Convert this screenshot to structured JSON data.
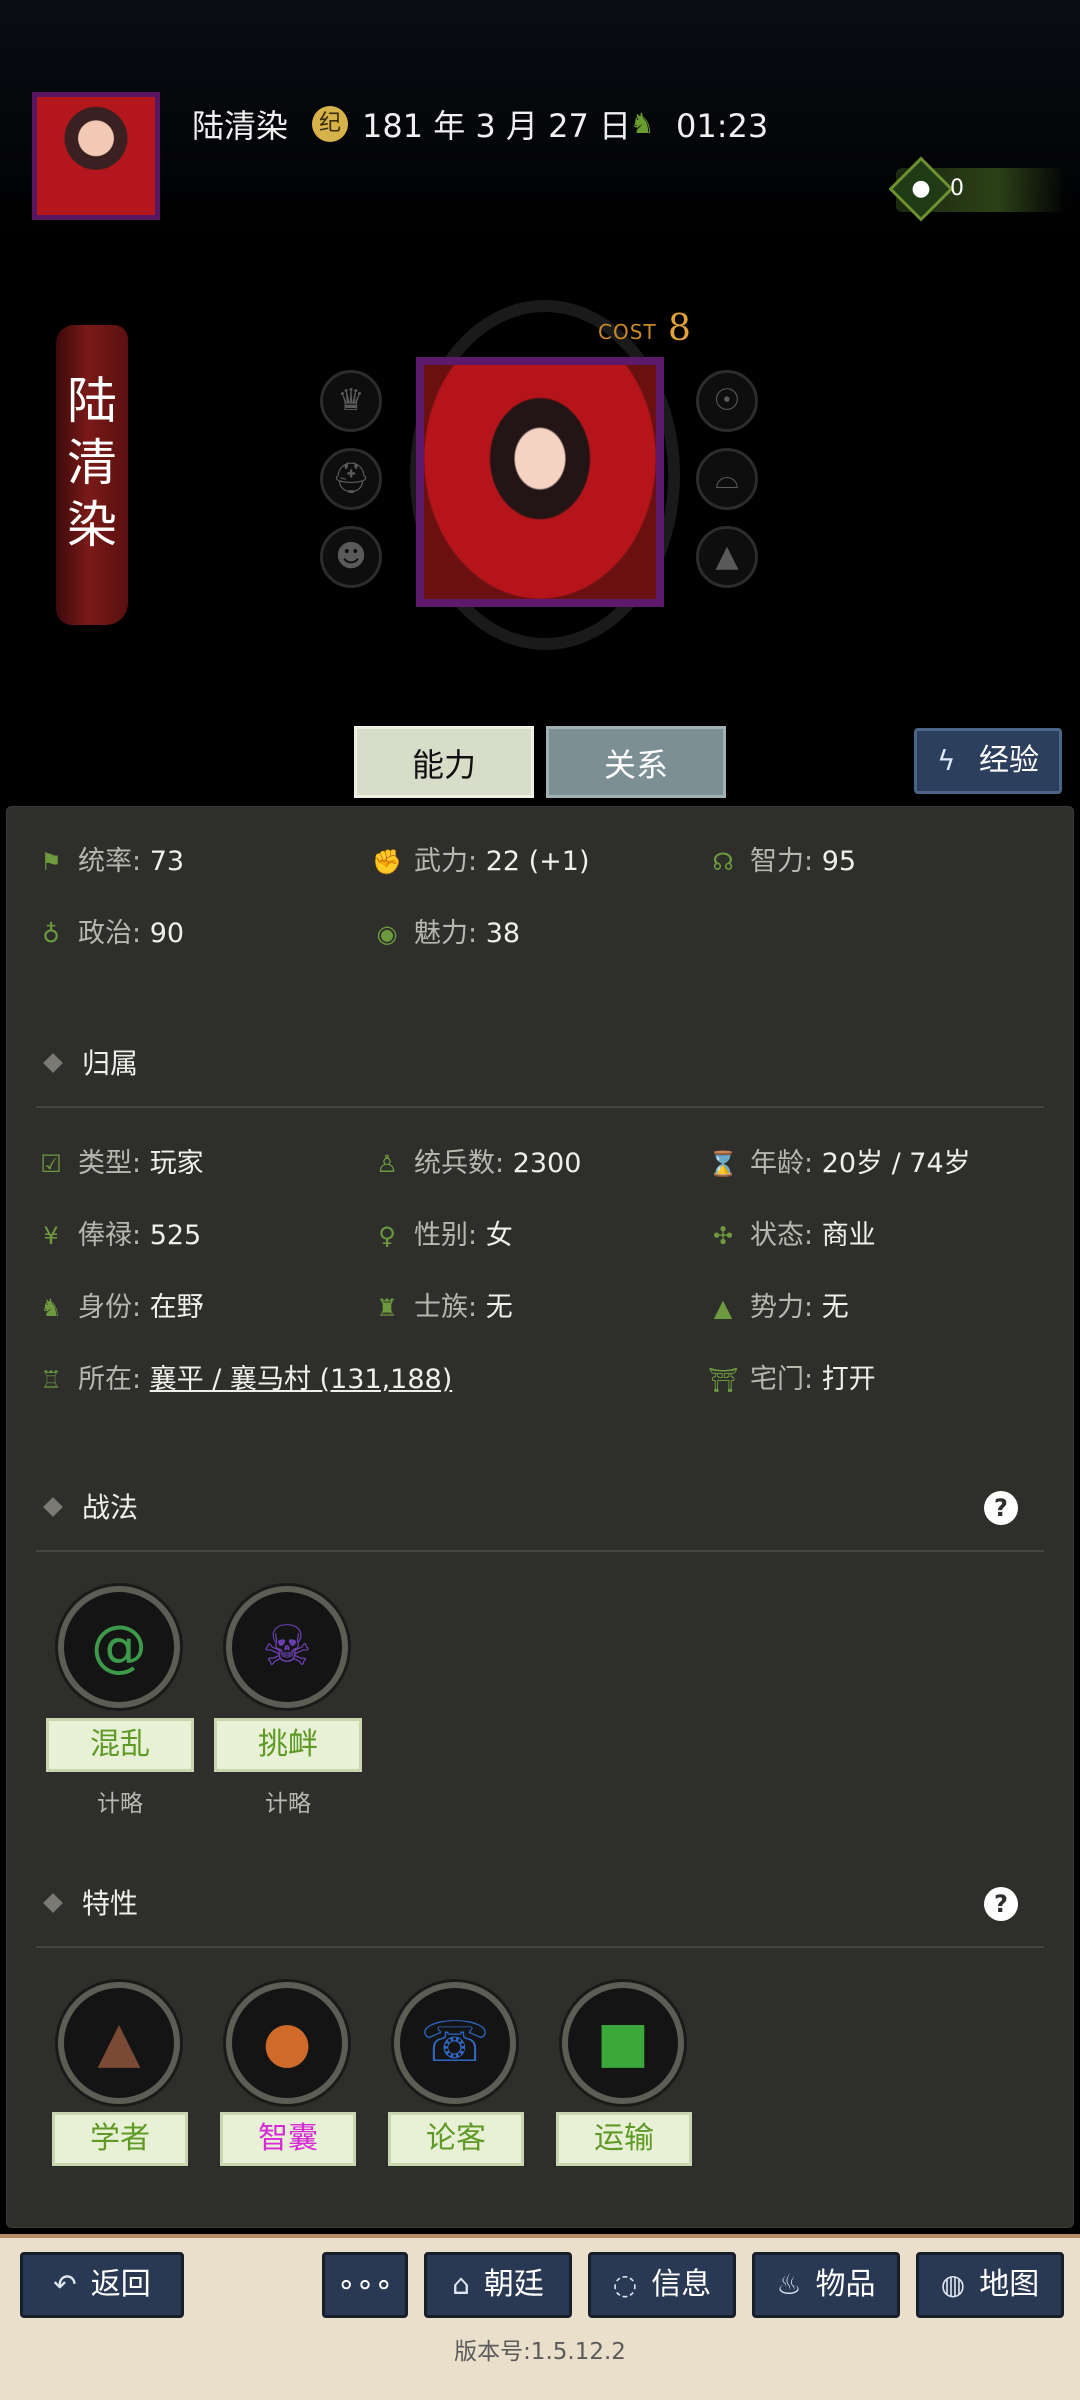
{
  "header": {
    "player_name": "陆清染",
    "date": "181 年 3 月 27 日",
    "time": "01:23",
    "gem_count": "0"
  },
  "character": {
    "name_vertical": [
      "陆",
      "清",
      "染"
    ],
    "cost_label": "COST",
    "cost_value": "8"
  },
  "tabs": {
    "ability": "能力",
    "relations": "关系",
    "experience": "经验"
  },
  "stats": [
    {
      "label": "统率",
      "value": "73",
      "icon": "flag-icon"
    },
    {
      "label": "武力",
      "value": "22 (+1)",
      "icon": "arm-icon"
    },
    {
      "label": "智力",
      "value": "95",
      "icon": "brain-icon"
    },
    {
      "label": "政治",
      "value": "90",
      "icon": "bag-icon"
    },
    {
      "label": "魅力",
      "value": "38",
      "icon": "eye-icon"
    }
  ],
  "affiliation": {
    "title": "归属",
    "fields": [
      {
        "label": "类型",
        "value": "玩家",
        "icon": "calendar-check-icon"
      },
      {
        "label": "统兵数",
        "value": "2300",
        "icon": "soldier-icon"
      },
      {
        "label": "年龄",
        "value": "20岁 / 74岁",
        "icon": "age-icon"
      },
      {
        "label": "俸禄",
        "value": "525",
        "icon": "yen-icon"
      },
      {
        "label": "性别",
        "value": "女",
        "icon": "gender-icon"
      },
      {
        "label": "状态",
        "value": "商业",
        "icon": "status-icon"
      },
      {
        "label": "身份",
        "value": "在野",
        "icon": "horse-icon"
      },
      {
        "label": "士族",
        "value": "无",
        "icon": "clan-icon"
      },
      {
        "label": "势力",
        "value": "无",
        "icon": "mountain-icon"
      },
      {
        "label": "所在",
        "value": "襄平 / 襄马村 (131,188)",
        "icon": "city-icon"
      },
      {
        "label": "宅门",
        "value": "打开",
        "icon": "gate-icon"
      }
    ]
  },
  "tactics": {
    "title": "战法",
    "help": "?",
    "items": [
      {
        "name": "混乱",
        "type": "计略",
        "color": "#3c9a4a",
        "icon": "swirl-icon"
      },
      {
        "name": "挑衅",
        "type": "计略",
        "color": "#6a3fb0",
        "icon": "demon-icon"
      }
    ]
  },
  "traits": {
    "title": "特性",
    "help": "?",
    "items": [
      {
        "name": "学者",
        "color": "#5f9a27",
        "icon_color": "#7a4a34",
        "icon": "graduation-cap-icon"
      },
      {
        "name": "智囊",
        "color": "#d829d8",
        "icon_color": "#d06a2a",
        "icon": "sack-icon"
      },
      {
        "name": "论客",
        "color": "#5f9a27",
        "icon_color": "#2e67c4",
        "icon": "speaker-icon"
      },
      {
        "name": "运输",
        "color": "#5f9a27",
        "icon_color": "#3aa83a",
        "icon": "box-icon"
      }
    ]
  },
  "nav": {
    "back": "返回",
    "more": "∘∘∘",
    "court": "朝廷",
    "info": "信息",
    "items": "物品",
    "map": "地图"
  },
  "version": "版本号:1.5.12.2"
}
